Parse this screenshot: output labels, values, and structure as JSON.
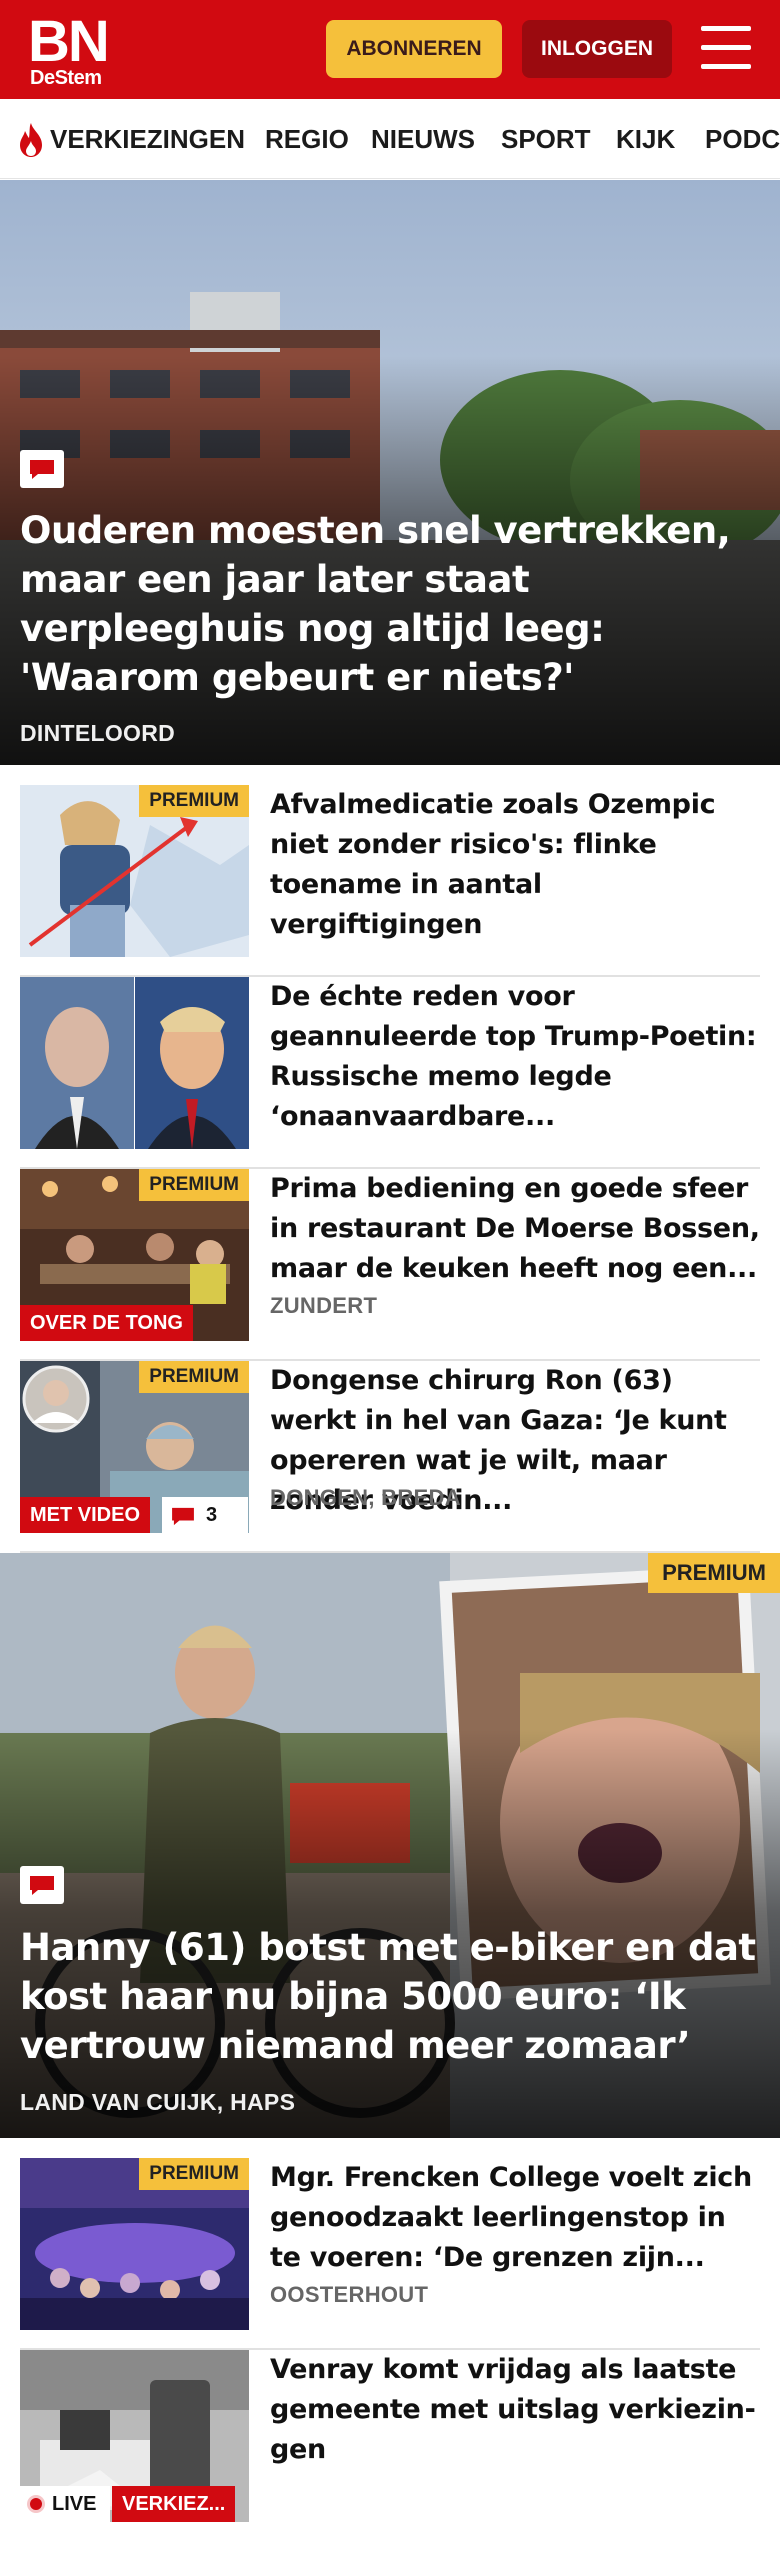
{
  "header": {
    "logo_big": "BN",
    "logo_small": "DeStem",
    "subscribe_label": "ABONNEREN",
    "login_label": "INLOGGEN",
    "brand_color": "#d10a11",
    "accent_color": "#f5c03b"
  },
  "nav": {
    "items": [
      {
        "label": "VERKIEZINGEN",
        "icon": "flame-icon"
      },
      {
        "label": "REGIO"
      },
      {
        "label": "NIEUWS"
      },
      {
        "label": "SPORT"
      },
      {
        "label": "KIJK"
      },
      {
        "label": "PODCAST"
      }
    ]
  },
  "hero1": {
    "title": "Ouderen moesten snel vertrekken, maar een jaar later staat verpleeghuis nog altijd leeg: 'Waarom gebeurt er niets?'",
    "location": "DINTELOORD",
    "icon": "comment-icon"
  },
  "articles": [
    {
      "title": "Afvalmedicatie zoals Ozempic niet zonder risico's: flinke toename in aantal vergiftigingen",
      "premium": "PREMIUM"
    },
    {
      "title": "De échte reden voor geannuleer­de top Trump-Poetin: Russische memo legde ‘onaanvaardbare..."
    },
    {
      "title": "Prima bediening en goede sfeer in restaurant De Moerse Bossen, maar de keuken heeft nog een...",
      "premium": "PREMIUM",
      "tag": "OVER DE TONG",
      "location": "ZUNDERT"
    },
    {
      "title": "Dongense chirurg Ron (63) werkt in hel van Gaza: ‘Je kunt opereren wat je wilt, maar zonder voedin...",
      "premium": "PREMIUM",
      "tag": "MET VIDEO",
      "comments": "3",
      "location": "DONGEN, BREDA"
    }
  ],
  "hero2": {
    "title": "Hanny (61) botst met e-biker en dat kost haar nu bijna 5000 euro: ‘Ik vertrouw niemand meer zomaar’",
    "location": "LAND VAN CUIJK, HAPS",
    "premium": "PREMIUM",
    "icon": "comment-icon"
  },
  "articles2": [
    {
      "title": "Mgr. Frencken College voelt zich genoodzaakt leerlingenstop in te voeren: ‘De grenzen zijn...",
      "premium": "PREMIUM",
      "location": "OOSTERHOUT"
    },
    {
      "title": "Venray komt vrijdag als laatste gemeente met uitslag verkiezin­gen",
      "live": "LIVE",
      "tag": "VERKIEZ..."
    }
  ]
}
